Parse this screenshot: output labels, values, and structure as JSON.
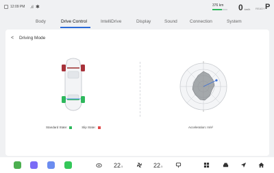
{
  "status": {
    "time": "12:09 PM",
    "range": "376 km",
    "speed_value": "0",
    "speed_unit": "km/h",
    "ready": "READY",
    "gear": "P",
    "range_fraction": 0.64
  },
  "tabs": [
    {
      "label": "Body"
    },
    {
      "label": "Drive Control"
    },
    {
      "label": "IntelliDrive"
    },
    {
      "label": "Display"
    },
    {
      "label": "Sound"
    },
    {
      "label": "Connection"
    },
    {
      "label": "System"
    }
  ],
  "active_tab": "Drive Control",
  "page": {
    "back_symbol": "<",
    "title": "Driving Mode"
  },
  "legend": {
    "standard_label": "Standard State:",
    "slip_label": "Slip State:",
    "standard_color": "#2eb85c",
    "slip_color": "#e04848"
  },
  "acceleration": {
    "label": "Acceleration: ",
    "unit": "m/s²"
  },
  "dock": {
    "apps": [
      {
        "icon": "green-app-icon",
        "color": "#4caf50"
      },
      {
        "icon": "purple-app-icon",
        "color": "#7b6cf6"
      },
      {
        "icon": "blue-app-icon",
        "color": "#6b8cf0"
      },
      {
        "icon": "phone-icon",
        "color": "#34c759"
      }
    ],
    "left_temp": "22",
    "right_temp": "22",
    "temp_unit": ".5",
    "icons": [
      "seat-heat-icon",
      "fan-icon",
      "seat-icon",
      "grid-icon",
      "car-icon",
      "navigate-icon",
      "home-icon"
    ]
  }
}
